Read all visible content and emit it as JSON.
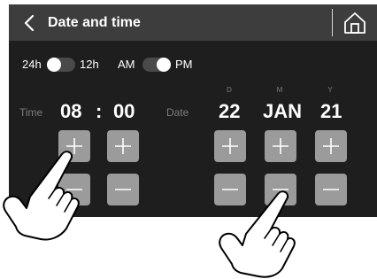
{
  "header": {
    "title": "Date and time",
    "back_icon": "chevron-left-icon",
    "home_icon": "home-icon"
  },
  "toggles": {
    "clock_format": {
      "left": "24h",
      "right": "12h",
      "selected": "24h"
    },
    "meridiem": {
      "left": "AM",
      "right": "PM",
      "selected": "PM"
    }
  },
  "time": {
    "label": "Time",
    "hours": "08",
    "separator": ":",
    "minutes": "00"
  },
  "date": {
    "label": "Date",
    "day_letter": "D",
    "month_letter": "M",
    "year_letter": "Y",
    "day": "22",
    "month": "JAN",
    "year": "21"
  },
  "colors": {
    "screen_bg": "#1e1e1e",
    "header_bg": "#3d3d3d",
    "button_bg": "#9b9b9b",
    "dim_text": "#7c7c7c"
  }
}
